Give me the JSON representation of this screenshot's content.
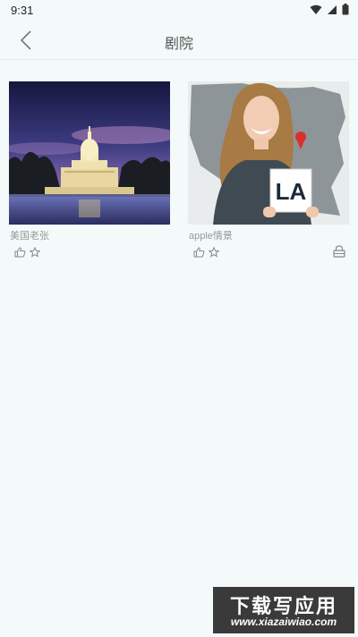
{
  "status": {
    "time": "9:31"
  },
  "header": {
    "title": "剧院"
  },
  "items": [
    {
      "title": "美国老张",
      "locked": false
    },
    {
      "title": "apple情景",
      "locked": true
    }
  ],
  "la_sign": "LA",
  "watermark": {
    "main": "下载写应用",
    "sub": "www.xiazaiwiao.com"
  }
}
